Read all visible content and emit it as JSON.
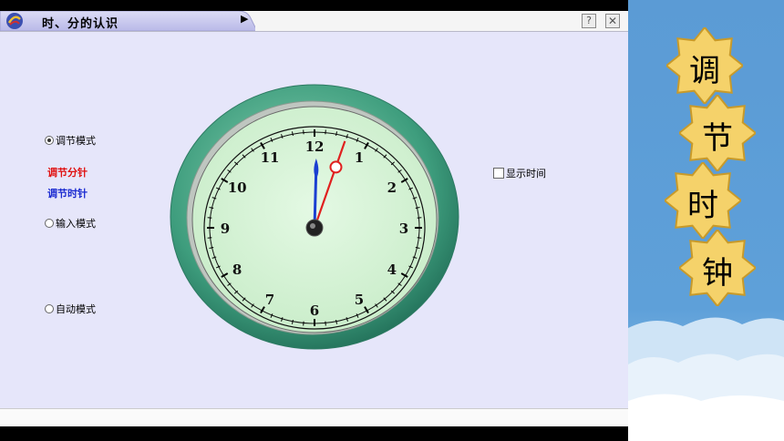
{
  "window": {
    "title": "时、分的认识",
    "tab_arrow": "▶",
    "help_label": "?",
    "close_label": "✕"
  },
  "modes": {
    "adjust": {
      "label": "调节模式",
      "selected": true
    },
    "adjust_minute": "调节分针",
    "adjust_hour": "调节时针",
    "input": {
      "label": "输入模式",
      "selected": false
    },
    "auto": {
      "label": "自动模式",
      "selected": false
    }
  },
  "show_time": {
    "label": "显示时间",
    "checked": false
  },
  "clock": {
    "numerals": [
      "12",
      "1",
      "2",
      "3",
      "4",
      "5",
      "6",
      "7",
      "8",
      "9",
      "10",
      "11"
    ],
    "hour": 12,
    "minute": 3,
    "colors": {
      "hour_hand": "#1a3fd1",
      "minute_hand": "#e0201f",
      "rim": "#3a9a7a",
      "face": "#d8f4d8"
    }
  },
  "side_banner": {
    "chars": [
      "调",
      "节",
      "时",
      "钟"
    ],
    "colors": {
      "star": "#f5d26a",
      "star_edge": "#c89a2a",
      "background": "#5b9bd5"
    }
  }
}
